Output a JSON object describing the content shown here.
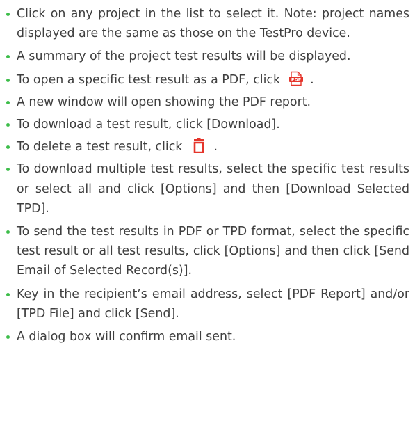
{
  "colors": {
    "bullet": "#3dbd4a",
    "text": "#3f3f3f",
    "pdf_icon": "#e5352b",
    "trash_icon": "#e5352b"
  },
  "icons": {
    "pdf": "pdf-icon",
    "delete": "trash-icon"
  },
  "items": [
    "Click on any project in the list to select it. Note: project names displayed are the same as those on the TestPro device.",
    "A summary of the project test results will be displayed.",
    {
      "before": "To open a specific test result as a PDF, click",
      "icon_text": "PDF",
      "after": "."
    },
    "A new window will open showing the PDF report.",
    "To download a test result, click [Download].",
    {
      "before": "To delete a test result, click",
      "after": "."
    },
    "To download multiple test results, select the specific test results or select all and click [Options] and then [Download Selected TPD].",
    "To send the test results in PDF or TPD format, select the specific test result or all test results, click [Options] and then click [Send Email of Selected Record(s)].",
    "Key in the recipient’s email address, select [PDF Report] and/or [TPD File] and click [Send].",
    "A dialog box will confirm email sent."
  ]
}
